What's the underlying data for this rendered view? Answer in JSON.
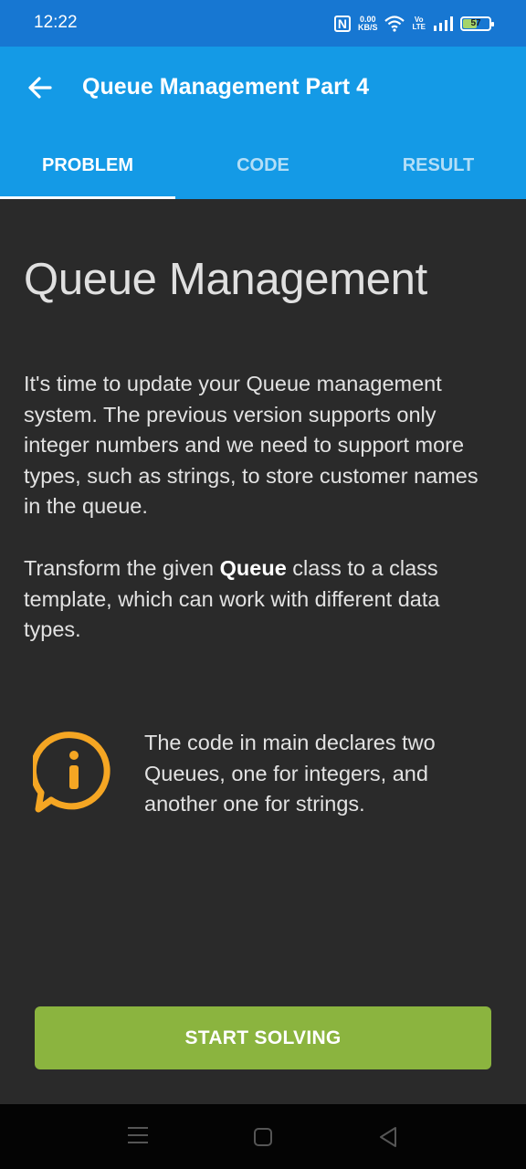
{
  "status_bar": {
    "time": "12:22",
    "nfc": "N",
    "net_speed_value": "0.00",
    "net_speed_unit": "KB/S",
    "volte_top": "Vo",
    "volte_bottom": "LTE",
    "battery_level": "57",
    "icons": [
      "nfc-icon",
      "wifi-icon",
      "volte-icon",
      "signal-icon",
      "battery-icon"
    ]
  },
  "app_bar": {
    "title": "Queue Management Part 4",
    "back_icon": "arrow-left-icon"
  },
  "tabs": [
    {
      "label": "PROBLEM",
      "active": true
    },
    {
      "label": "CODE",
      "active": false
    },
    {
      "label": "RESULT",
      "active": false
    }
  ],
  "content": {
    "heading": "Queue Management",
    "paragraph1": "It's time to update your Queue management system. The previous version supports only integer numbers and we need to support more types, such as strings, to store customer names in the queue.",
    "paragraph2_before": "Transform the given ",
    "paragraph2_bold": "Queue",
    "paragraph2_after": " class to a class template, which can work with different data types.",
    "note_icon": "info-speech-bubble-icon",
    "note": "The code in main declares two Queues, one for integers, and another one for strings."
  },
  "action": {
    "start_label": "START SOLVING"
  },
  "navigation_bar": {
    "icons": [
      "menu-icon",
      "home-icon",
      "back-triangle-icon"
    ]
  },
  "colors": {
    "status_bar": "#1777d2",
    "app_bar": "#149ae6",
    "background": "#2a2a2a",
    "accent_orange": "#f5a623",
    "button_green": "#8bb43f",
    "battery_fill": "#a5d46a"
  }
}
